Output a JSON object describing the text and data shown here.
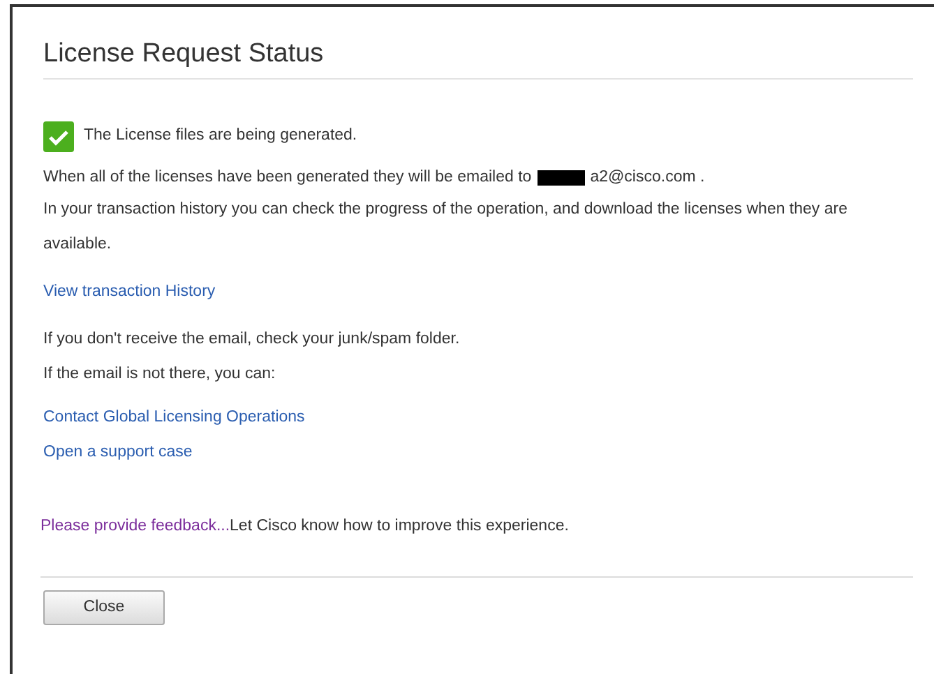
{
  "dialog": {
    "title": "License Request Status",
    "status": {
      "ok": true,
      "message": "The License files are being generated."
    },
    "email_line": {
      "text": "When all of the licenses have been generated they will be emailed to",
      "redacted": true,
      "email": "a2@cisco.com ."
    },
    "history_text": "In your transaction history you can check the progress of the operation, and download the licenses when they are available.",
    "history_link": "View transaction History",
    "help_lines": [
      "If you don't receive the email, check your junk/spam folder.",
      "If the email is not there, you can:"
    ],
    "links": [
      "Contact Global Licensing Operations",
      "Open a support case"
    ],
    "feedback": {
      "link": "Please provide feedback...",
      "text": "Let Cisco know how to improve this experience."
    },
    "buttons": [
      "Close"
    ]
  }
}
